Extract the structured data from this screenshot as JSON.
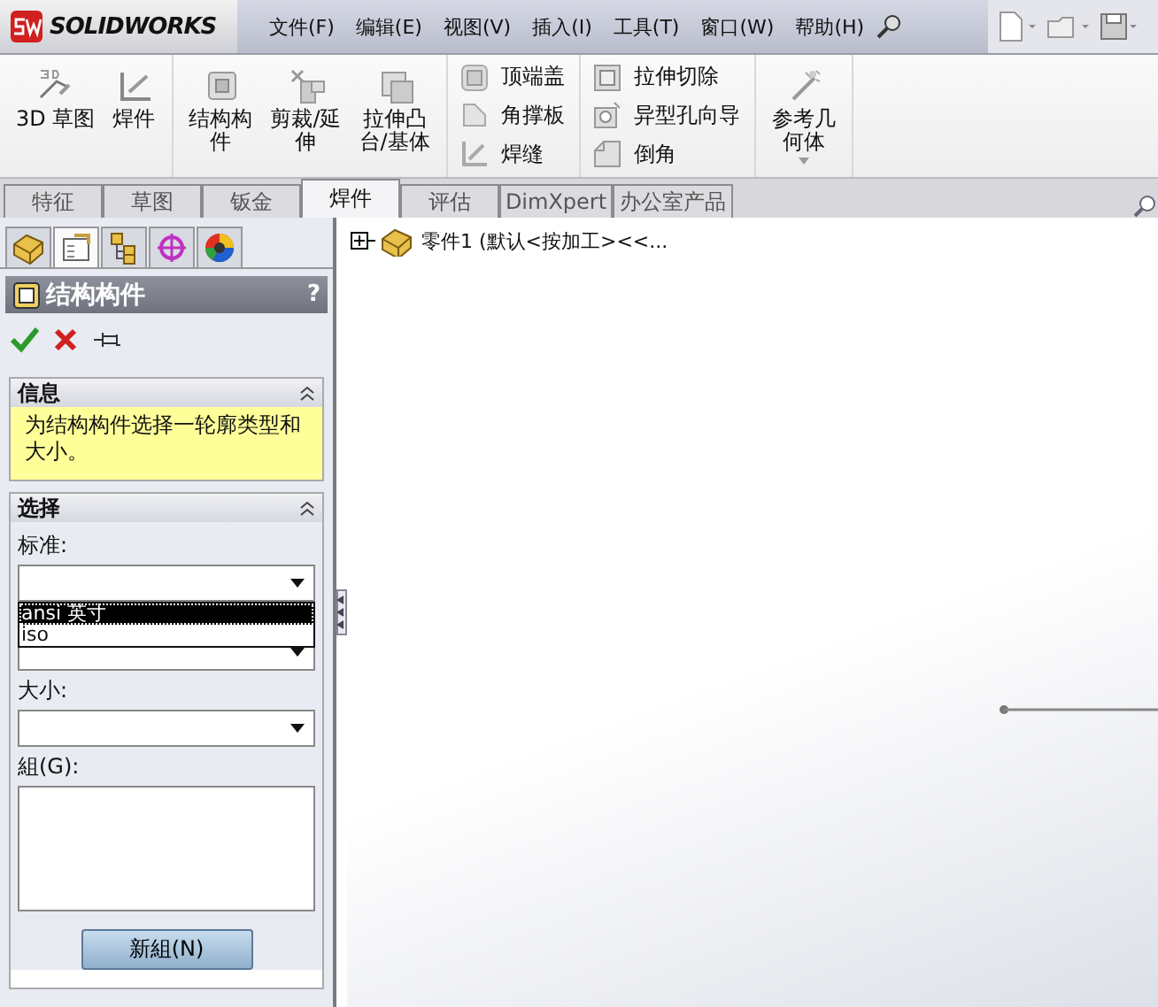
{
  "app": {
    "logo": "SOLIDWORKS"
  },
  "menu": [
    "文件(F)",
    "编辑(E)",
    "视图(V)",
    "插入(I)",
    "工具(T)",
    "窗口(W)",
    "帮助(H)"
  ],
  "ribbon": {
    "groups": [
      {
        "kind": "large",
        "items": [
          {
            "lines": [
              "3D 草图"
            ]
          },
          {
            "lines": [
              "焊件"
            ]
          }
        ]
      },
      {
        "kind": "large",
        "items": [
          {
            "lines": [
              "结构构",
              "件"
            ]
          },
          {
            "lines": [
              "剪裁/延",
              "伸"
            ]
          },
          {
            "lines": [
              "拉伸凸",
              "台/基体"
            ]
          }
        ]
      },
      {
        "kind": "small",
        "items": [
          {
            "lines": [
              "顶端盖"
            ]
          },
          {
            "lines": [
              "角撑板"
            ]
          },
          {
            "lines": [
              "焊缝"
            ]
          }
        ]
      },
      {
        "kind": "small",
        "items": [
          {
            "lines": [
              "拉伸切除"
            ]
          },
          {
            "lines": [
              "异型孔向导"
            ]
          },
          {
            "lines": [
              "倒角"
            ]
          }
        ]
      },
      {
        "kind": "dropdown",
        "items": [
          {
            "lines": [
              "参考几",
              "何体"
            ]
          }
        ]
      }
    ]
  },
  "tabs": [
    {
      "label": "特征",
      "selected": false
    },
    {
      "label": "草图",
      "selected": false
    },
    {
      "label": "钣金",
      "selected": false
    },
    {
      "label": "焊件",
      "selected": true
    },
    {
      "label": "评估",
      "selected": false
    },
    {
      "label": "DimXpert",
      "selected": false
    },
    {
      "label": "办公室产品",
      "selected": false
    }
  ],
  "panel": {
    "icon_tabs": [
      {
        "selected": false
      },
      {
        "selected": true
      },
      {
        "selected": false
      },
      {
        "selected": false
      },
      {
        "selected": false
      }
    ],
    "title": "结构构件",
    "help": "?",
    "info": {
      "header": "信息",
      "text": "为结构构件选择一轮廓类型和大小。"
    },
    "selection": {
      "header": "选择",
      "standard_label": "标准:",
      "standard_options": [
        {
          "label": "ansi 英寸",
          "selected": true
        },
        {
          "label": "iso",
          "selected": false
        }
      ],
      "size_label": "大小:",
      "group_label": "組(G):",
      "new_group_button": "新組(N)"
    }
  },
  "tree": {
    "root": "零件1 (默认<按加工><<..."
  }
}
